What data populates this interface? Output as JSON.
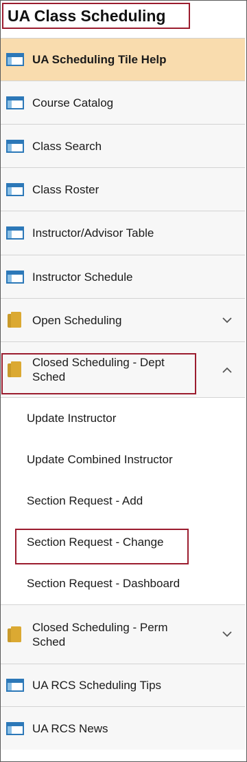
{
  "title": "UA Class Scheduling",
  "colors": {
    "highlight_border": "#9b1c2e",
    "active_bg": "#f9dcae",
    "window_icon": "#2c78b8",
    "folder_icon": "#c99a2a"
  },
  "nav": {
    "items": [
      {
        "label": "UA Scheduling Tile Help",
        "icon": "window-icon",
        "active": true
      },
      {
        "label": "Course Catalog",
        "icon": "window-icon"
      },
      {
        "label": "Class Search",
        "icon": "window-icon"
      },
      {
        "label": "Class Roster",
        "icon": "window-icon"
      },
      {
        "label": "Instructor/Advisor Table",
        "icon": "window-icon"
      },
      {
        "label": "Instructor Schedule",
        "icon": "window-icon"
      },
      {
        "label": "Open Scheduling",
        "icon": "folder-icon",
        "expanded": false
      },
      {
        "label": "Closed Scheduling - Dept Sched",
        "icon": "folder-icon",
        "expanded": true,
        "children": [
          {
            "label": "Update Instructor"
          },
          {
            "label": "Update Combined Instructor"
          },
          {
            "label": "Section Request - Add"
          },
          {
            "label": "Section Request - Change",
            "highlighted": true
          },
          {
            "label": "Section Request - Dashboard"
          }
        ]
      },
      {
        "label": "Closed Scheduling - Perm Sched",
        "icon": "folder-icon",
        "expanded": false
      },
      {
        "label": "UA RCS Scheduling Tips",
        "icon": "window-icon"
      },
      {
        "label": "UA RCS News",
        "icon": "window-icon"
      }
    ]
  }
}
